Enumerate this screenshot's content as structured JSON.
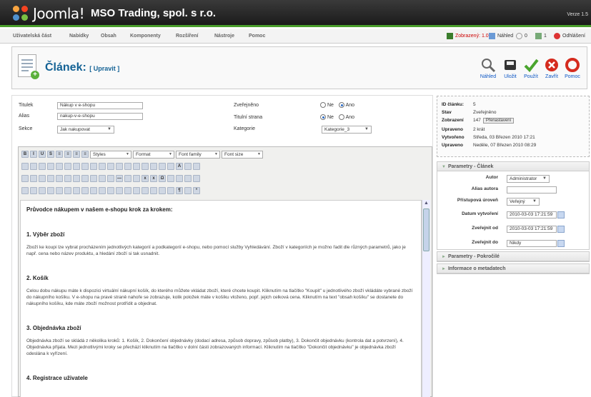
{
  "header": {
    "brand": "Joomla!",
    "site_name": "MSO Trading, spol. s r.o.",
    "version": "Verze 1.5"
  },
  "menu": [
    "Uživatelská část",
    "Nabídky",
    "Obsah",
    "Komponenty",
    "Rozšíření",
    "Nástroje",
    "Pomoc"
  ],
  "status": {
    "shown": "Zobrazený: 1.0",
    "preview": "Náhled",
    "messages": "0",
    "users": "1",
    "logout": "Odhlášení"
  },
  "page": {
    "title": "Článek:",
    "subtitle": "[ Upravit ]"
  },
  "toolbar": {
    "preview": "Náhled",
    "save": "Uložit",
    "apply": "Použít",
    "close": "Zavřít",
    "help": "Pomoc"
  },
  "form": {
    "title_label": "Titulek",
    "title_value": "Nákup v e-shopu",
    "alias_label": "Alias",
    "alias_value": "nakup-v-e-shopu",
    "section_label": "Sekce",
    "section_value": "Jak nakupovat",
    "published_label": "Zveřejněno",
    "frontpage_label": "Titulní strana",
    "no": "Ne",
    "yes": "Ano",
    "category_label": "Kategorie",
    "category_value": "Kategorie_3"
  },
  "editor": {
    "styles": "Styles",
    "format": "Format",
    "font_family": "Font family",
    "font_size": "Font size",
    "heading": "Průvodce nákupem v našem e-shopu krok za krokem:",
    "s1_title": "1. Výběr zboží",
    "s1_text": "Zboží ke koupi lze vybrat procházením jednotlivých kategorií a podkategorií e-shopu, nebo pomocí služby Vyhledávání. Zboží v kategoriích je možno řadit dle různých parametrů, jako je např. cena nebo název produktu, a hledání zboží si tak usnadnit.",
    "s2_title": "2. Košík",
    "s2_text": "Celou dobu nákupu máte k dispozici virtuální nákupní košík, do kterého můžete vkládat zboží, které chcete koupit. Kliknutím na tlačítko \"Koupit\" u jednotlivého zboží vkládáte vybrané zboží do nákupního košíku. V e-shopu na pravé straně nahoře se zobrazuje, kolik položek máte v košíku vloženo, popř. jejich celková cena. Kliknutím na text \"obsah košíku\" se dostanete do nákupního košíku, kde máte zboží možnost protřídit a objednat.",
    "s3_title": "3. Objednávka zboží",
    "s3_text": "Objednávka zboží se skládá z několika kroků: 1. Košík, 2. Dokončení objednávky (dodací adresa, způsob dopravy, způsob platby), 3. Dokončit objednávku (kontrola dat a potvrzení), 4. Objednávka přijata. Mezi jednotlivými kroky se přechází kliknutím na tlačítko v dolní části zobrazovaných informací. Kliknutím na tlačítko \"Dokončit objednávku\" je objednávka zboží odeslána k vyřízení.",
    "s4_title": "4. Registrace uživatele"
  },
  "info": {
    "id_label": "ID článku:",
    "id_value": "5",
    "state_label": "Stav",
    "state_value": "Zveřejněno",
    "hits_label": "Zobrazení",
    "hits_value": "147",
    "reset": "Přenastavení",
    "revised_label": "Upraveno",
    "revised_value": "2 krát",
    "created_label": "Vytvořeno",
    "created_value": "Středa, 03 Březen 2010 17:21",
    "modified_label": "Upraveno",
    "modified_value": "Neděle, 07 Březen 2010 08:29"
  },
  "params": {
    "head": "Parametry - Článek",
    "author_label": "Autor",
    "author_value": "Administrator",
    "alias_label": "Alias autora",
    "alias_value": "",
    "access_label": "Přístupová úroveň",
    "access_value": "Veřejný",
    "created_label": "Datum vytvoření",
    "created_value": "2010-03-03 17:21:59",
    "pub_up_label": "Zveřejnit od",
    "pub_up_value": "2010-03-03 17:21:59",
    "pub_down_label": "Zveřejnit do",
    "pub_down_value": "Nikdy"
  },
  "advanced": {
    "head": "Parametry - Pokročilé"
  },
  "meta": {
    "head": "Informace o metadatech"
  },
  "colors": {
    "header": "#1b1b1b",
    "accent": "#4a9f2c",
    "title": "#146295",
    "link": "#0b55c4"
  }
}
